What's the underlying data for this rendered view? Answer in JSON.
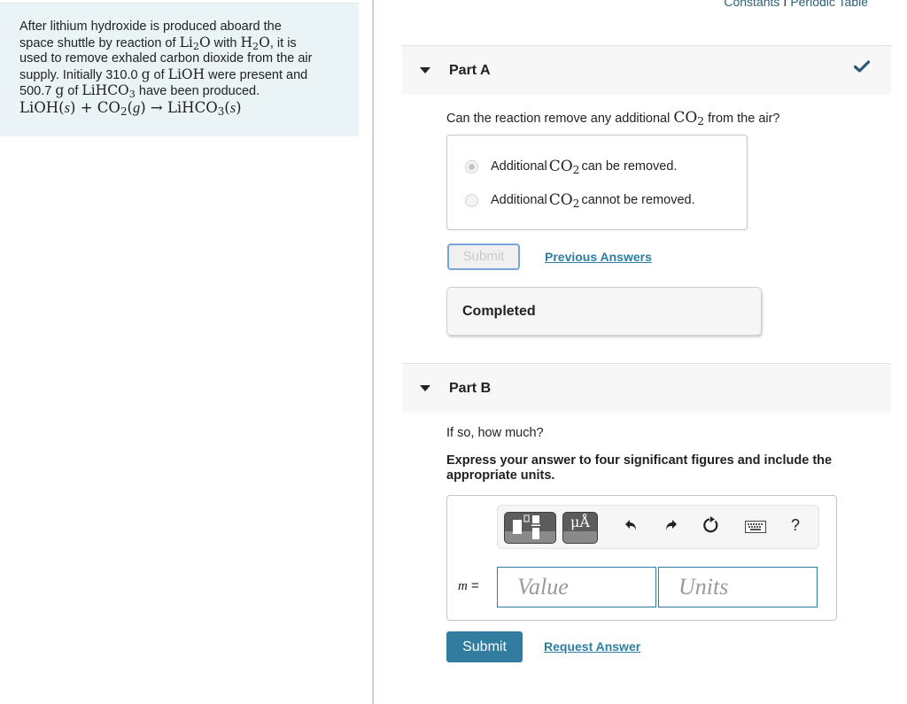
{
  "problem": {
    "intro_1": "After lithium hydroxide is produced aboard the",
    "intro_2a": "space shuttle by reaction of ",
    "li2o_base": "Li",
    "li2o_sub": "2",
    "li2o_end": "O",
    "intro_2b": " with ",
    "h2o_base": "H",
    "h2o_sub": "2",
    "h2o_end": "O",
    "intro_2c": ", it is",
    "intro_3": "used to remove exhaled carbon dioxide from the air",
    "intro_4a": "supply. Initially 310.0 ",
    "unit_g": "g",
    "intro_4b": " of ",
    "lioh": "LiOH",
    "intro_4c": " were present and",
    "intro_5a": "500.7 ",
    "intro_5b": " of ",
    "lihco3_base": "LiHCO",
    "lihco3_sub": "3",
    "intro_5c": " have been produced.",
    "equation": {
      "r1": "LiOH(",
      "s": "s",
      "r1_end": ")",
      "plus": " + ",
      "r2": "CO",
      "r2_sub": "2",
      "r2_open": "(",
      "g": "g",
      "r2_end": ")",
      "arrow": " → ",
      "p": "LiHCO",
      "p_sub": "3",
      "p_open": "(",
      "p_end": ")"
    }
  },
  "top_links": {
    "constants": "Constants",
    "separator": "I",
    "periodic_table": "Periodic Table"
  },
  "part_a": {
    "label": "Part A",
    "status": "correct",
    "question_a": "Can the reaction remove any additional ",
    "co2_base": "CO",
    "co2_sub": "2",
    "question_b": " from the air?",
    "choices": [
      {
        "pre": "Additional ",
        "post": " can be removed.",
        "selected": true
      },
      {
        "pre": "Additional ",
        "post": " cannot be removed.",
        "selected": false
      }
    ],
    "submit_label": "Submit",
    "previous_answers": "Previous Answers",
    "completed": "Completed"
  },
  "part_b": {
    "label": "Part B",
    "question": "If so, how much?",
    "instruction": "Express your answer to four significant figures and include the appropriate units.",
    "toolbar": {
      "templates_icon": "templates-icon",
      "symbols_label": "μÅ",
      "undo_icon": "undo-icon",
      "redo_icon": "redo-icon",
      "reset_icon": "reset-icon",
      "keyboard_icon": "keyboard-icon",
      "help_label": "?"
    },
    "variable": "m",
    "equals": " =",
    "value_placeholder": "Value",
    "units_placeholder": "Units",
    "submit_label": "Submit",
    "request_answer": "Request Answer"
  },
  "colors": {
    "accent": "#327c9f",
    "link": "#2d7ea2",
    "check": "#2a5a72",
    "panel_bg": "#eaf4f7"
  }
}
